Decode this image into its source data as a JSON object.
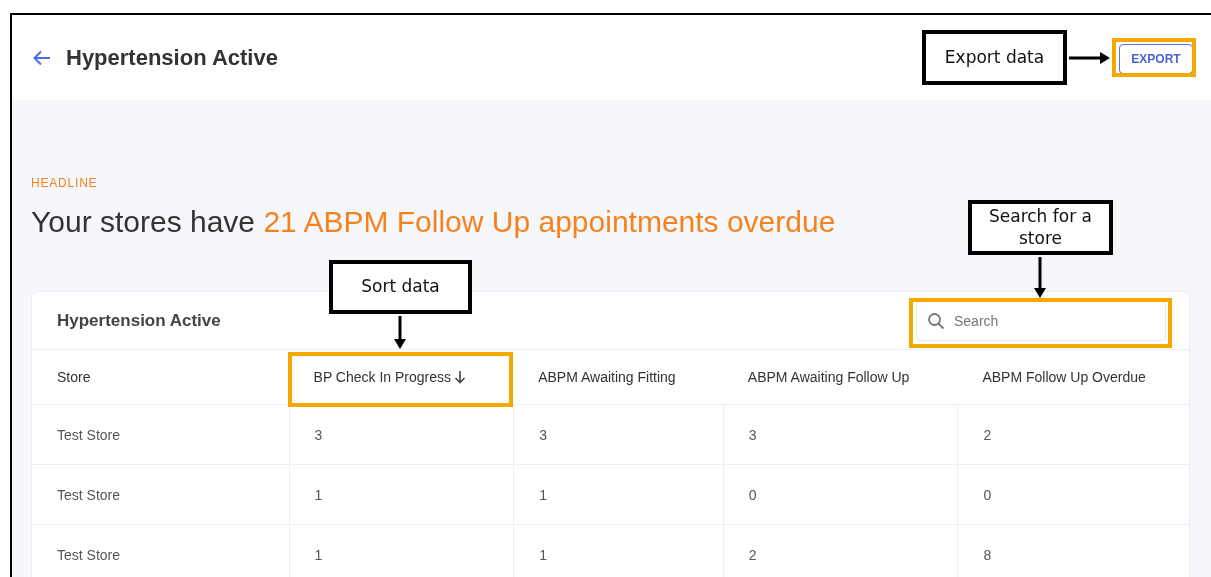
{
  "header": {
    "title": "Hypertension Active",
    "export_button": "EXPORT"
  },
  "headline": {
    "label": "HEADLINE",
    "text": "Your stores have ",
    "highlight": "21 ABPM Follow Up appointments overdue"
  },
  "table": {
    "title": "Hypertension Active",
    "search": {
      "placeholder": "Search"
    },
    "columns": [
      {
        "label": "Store",
        "sorted": false
      },
      {
        "label": "BP Check In Progress",
        "sorted": true
      },
      {
        "label": "ABPM Awaiting Fitting",
        "sorted": false
      },
      {
        "label": "ABPM Awaiting Follow Up",
        "sorted": false
      },
      {
        "label": "ABPM Follow Up Overdue",
        "sorted": false
      }
    ],
    "rows": [
      [
        "Test Store",
        "3",
        "3",
        "3",
        "2"
      ],
      [
        "Test Store",
        "1",
        "1",
        "0",
        "0"
      ],
      [
        "Test Store",
        "1",
        "1",
        "2",
        "8"
      ]
    ]
  },
  "callouts": [
    {
      "kind": "export",
      "text": "Export data"
    },
    {
      "kind": "search",
      "text": "Search for a store"
    },
    {
      "kind": "sort",
      "text": "Sort data"
    }
  ]
}
